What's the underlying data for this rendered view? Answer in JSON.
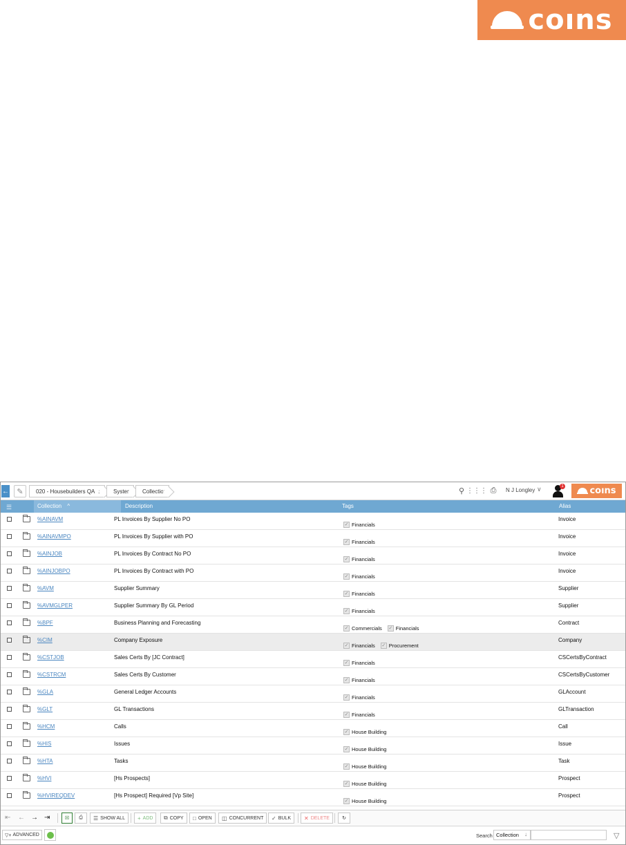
{
  "brand": {
    "logo_text": "coıns",
    "accent": "#ef8a4f"
  },
  "header": {
    "breadcrumbs": [
      {
        "label": "020 - Housebuilders QA",
        "has_dropdown": true
      },
      {
        "label": "System"
      },
      {
        "label": "Collections"
      }
    ],
    "user_name": "N J Longley",
    "notification_count": "1",
    "icons": [
      "back-arrow-icon",
      "pin-icon",
      "search-icon",
      "apps-grid-icon",
      "print-icon",
      "chevron-down-icon",
      "user-icon"
    ]
  },
  "grid": {
    "columns": {
      "collection": "Collection",
      "description": "Description",
      "tags": "Tags",
      "alias": "Alias"
    },
    "sort_indicator": "^",
    "header_color": "#6fa8d2",
    "rows": [
      {
        "code": "%AINAVM",
        "description": "PL Invoices By Supplier No PO",
        "tags": [
          "Financials"
        ],
        "alias": "Invoice"
      },
      {
        "code": "%AINAVMPO",
        "description": "PL Invoices By Supplier with PO",
        "tags": [
          "Financials"
        ],
        "alias": "Invoice"
      },
      {
        "code": "%AINJOB",
        "description": "PL Invoices By Contract No PO",
        "tags": [
          "Financials"
        ],
        "alias": "Invoice"
      },
      {
        "code": "%AINJOBPO",
        "description": "PL Invoices By Contract with PO",
        "tags": [
          "Financials"
        ],
        "alias": "Invoice"
      },
      {
        "code": "%AVM",
        "description": "Supplier Summary",
        "tags": [
          "Financials"
        ],
        "alias": "Supplier"
      },
      {
        "code": "%AVMGLPER",
        "description": "Supplier Summary By GL Period",
        "tags": [
          "Financials"
        ],
        "alias": "Supplier"
      },
      {
        "code": "%BPF",
        "description": "Business Planning and Forecasting",
        "tags": [
          "Commercials",
          "Financials"
        ],
        "alias": "Contract"
      },
      {
        "code": "%CIM",
        "description": "Company Exposure",
        "tags": [
          "Financials",
          "Procurement"
        ],
        "alias": "Company",
        "selected": true
      },
      {
        "code": "%CSTJOB",
        "description": "Sales Certs By [JC Contract]",
        "tags": [
          "Financials"
        ],
        "alias": "CSCertsByContract"
      },
      {
        "code": "%CSTRCM",
        "description": "Sales Certs By Customer",
        "tags": [
          "Financials"
        ],
        "alias": "CSCertsByCustomer"
      },
      {
        "code": "%GLA",
        "description": "General Ledger Accounts",
        "tags": [
          "Financials"
        ],
        "alias": "GLAccount"
      },
      {
        "code": "%GLT",
        "description": "GL Transactions",
        "tags": [
          "Financials"
        ],
        "alias": "GLTransaction"
      },
      {
        "code": "%HCM",
        "description": "Calls",
        "tags": [
          "House Building"
        ],
        "alias": "Call"
      },
      {
        "code": "%HIS",
        "description": "Issues",
        "tags": [
          "House Building"
        ],
        "alias": "Issue"
      },
      {
        "code": "%HTA",
        "description": "Tasks",
        "tags": [
          "House Building"
        ],
        "alias": "Task"
      },
      {
        "code": "%HVI",
        "description": "[Hs Prospects]",
        "tags": [
          "House Building"
        ],
        "alias": "Prospect"
      },
      {
        "code": "%HVIREQDEV",
        "description": "[Hs Prospect] Required [Vp Site]",
        "tags": [
          "House Building"
        ],
        "alias": "Prospect"
      }
    ]
  },
  "toolbar": {
    "show_all": "SHOW ALL",
    "add": "ADD",
    "copy": "COPY",
    "open": "OPEN",
    "concurrent": "CONCURRENT",
    "bulk": "BULK",
    "delete": "DELETE"
  },
  "footer": {
    "advanced": "ADVANCED",
    "search_label": "Search",
    "search_field": "Collection",
    "search_value": ""
  }
}
